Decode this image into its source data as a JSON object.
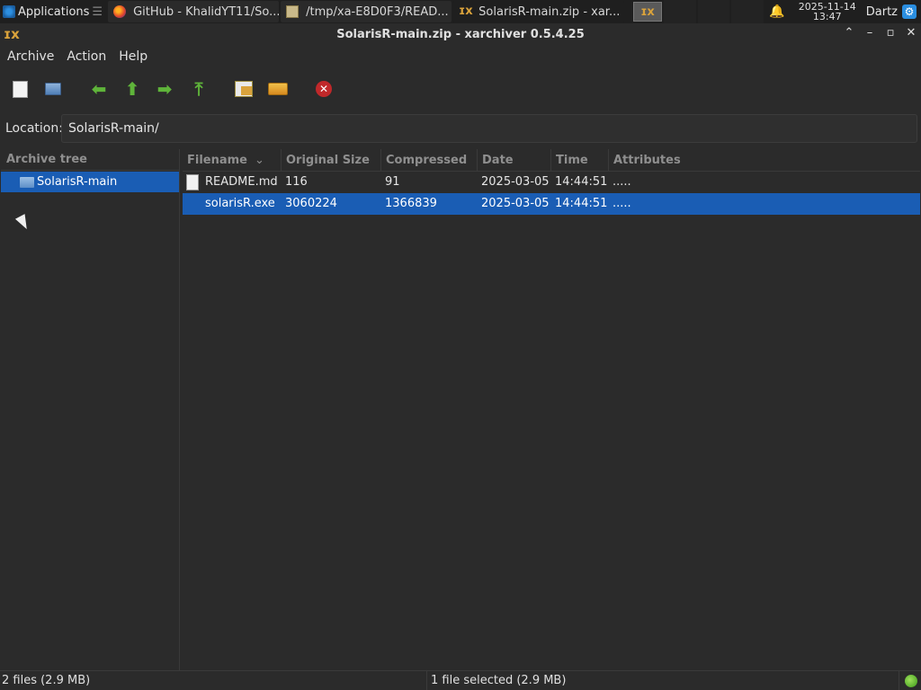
{
  "panel": {
    "apps_label": "Applications",
    "tasks": [
      {
        "label": "GitHub - KhalidYT11/So...",
        "icon": "firefox-icon"
      },
      {
        "label": "/tmp/xa-E8D0F3/READ...",
        "icon": "text-file-icon"
      },
      {
        "label": "SolarisR-main.zip - xar...",
        "icon": "xarchiver-icon"
      }
    ],
    "clock_date": "2025-11-14",
    "clock_time": "13:47",
    "user": "Dartz"
  },
  "window": {
    "title": "SolarisR-main.zip - xarchiver 0.5.4.25"
  },
  "menu": {
    "items": [
      "Archive",
      "Action",
      "Help"
    ]
  },
  "location": {
    "label": "Location:",
    "value": "SolarisR-main/"
  },
  "tree": {
    "header": "Archive tree",
    "items": [
      {
        "label": "SolarisR-main",
        "selected": true
      }
    ]
  },
  "table": {
    "columns": [
      "Filename",
      "Original Size",
      "Compressed",
      "Date",
      "Time",
      "Attributes"
    ],
    "rows": [
      {
        "filename": "README.md",
        "original_size": "116",
        "compressed": "91",
        "date": "2025-03-05",
        "time": "14:44:51",
        "attributes": ".....",
        "selected": false
      },
      {
        "filename": "solarisR.exe",
        "original_size": "3060224",
        "compressed": "1366839",
        "date": "2025-03-05",
        "time": "14:44:51",
        "attributes": ".....",
        "selected": true
      }
    ]
  },
  "status": {
    "left": "2 files  (2.9 MB)",
    "middle": "1 file selected  (2.9 MB)"
  },
  "colors": {
    "selection": "#1a5db4",
    "background": "#2b2b2b",
    "accent_arrows": "#5fb43a"
  }
}
